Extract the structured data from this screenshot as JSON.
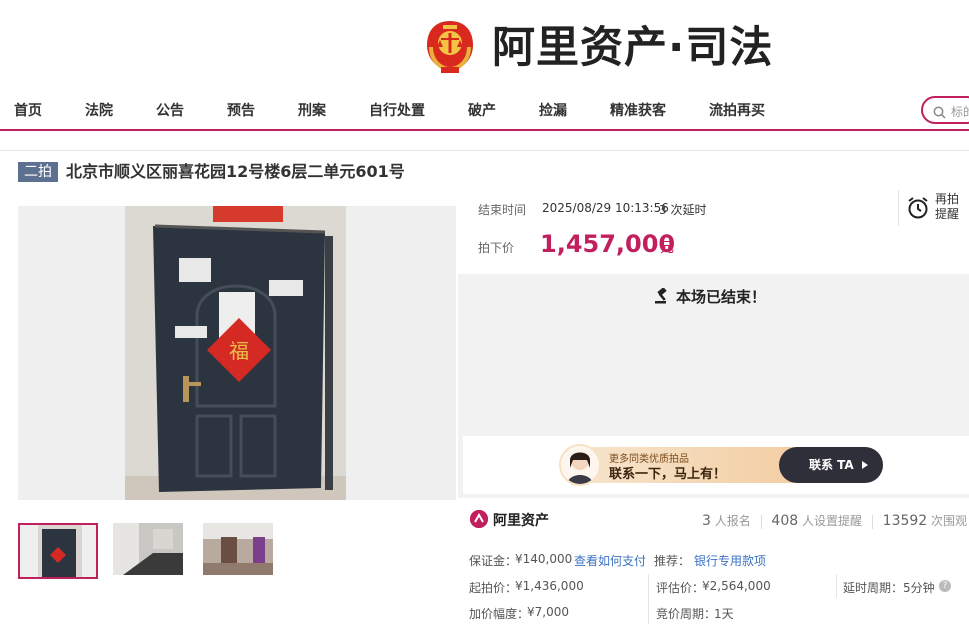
{
  "header": {
    "logo_text": "阿里资产·司法"
  },
  "nav": {
    "items": [
      {
        "label": "首页"
      },
      {
        "label": "法院"
      },
      {
        "label": "公告"
      },
      {
        "label": "预告"
      },
      {
        "label": "刑案"
      },
      {
        "label": "自行处置"
      },
      {
        "label": "破产"
      },
      {
        "label": "捡漏"
      },
      {
        "label": "精准获客"
      },
      {
        "label": "流拍再买"
      }
    ],
    "search_placeholder": "标的",
    "accent_color": "#c21f5d"
  },
  "lot": {
    "badge": "二拍",
    "title": "北京市顺义区丽喜花园12号楼6层二单元601号"
  },
  "auction": {
    "end_time_label": "结束时间",
    "end_time": "2025/08/29 10:13:56",
    "delays": "3 次延时",
    "price_label": "拍下价",
    "price": "1,457,000",
    "price_unit": "元",
    "remind_label": "再拍提醒",
    "ended_text": "本场已结束！"
  },
  "banner": {
    "small_text": "更多同类优质拍品",
    "big_text": "联系一下，马上有！",
    "button_label": "联系 TA"
  },
  "org": {
    "name": "阿里资产",
    "signups": "3",
    "signups_label": "人报名",
    "reminders": "408",
    "reminders_label": "人设置提醒",
    "views": "13592",
    "views_label": "次围观"
  },
  "details": {
    "deposit_label": "保证金：",
    "deposit": "¥140,000",
    "how_to_pay": "查看如何支付",
    "recommend_label": "推荐：",
    "recommend_link": "银行专用款项",
    "start_price_label": "起拍价：",
    "start_price": "¥1,436,000",
    "eval_price_label": "评估价：",
    "eval_price": "¥2,564,000",
    "delay_period_label": "延时周期：",
    "delay_period": "5分钟",
    "increment_label": "加价幅度：",
    "increment": "¥7,000",
    "bid_period_label": "竞价周期：",
    "bid_period": "1天"
  },
  "gallery": {
    "thumbnails": [
      {
        "label": "door-photo"
      },
      {
        "label": "stairwell-photo"
      },
      {
        "label": "hallway-photo"
      }
    ]
  }
}
